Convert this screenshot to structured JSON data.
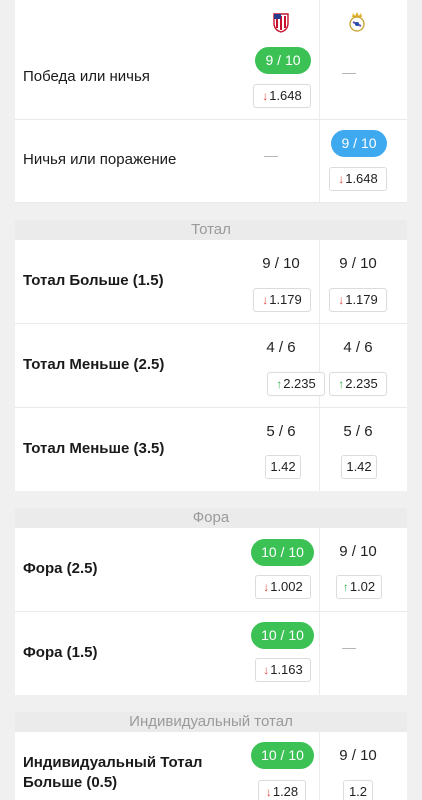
{
  "header": {
    "team1_logo": "atletico-crest-icon",
    "team2_logo": "real-madrid-crest-icon"
  },
  "sections": {
    "total": "Тотал",
    "fora": "Фора",
    "individual": "Индивидуальный тотал"
  },
  "rows": {
    "win_draw": {
      "label": "Победа или ничья",
      "t1_frac": "9 / 10",
      "t1_odds": "1.648",
      "t1_dir": "down"
    },
    "draw_lose": {
      "label": "Ничья или поражение",
      "t2_frac": "9 / 10",
      "t2_odds": "1.648",
      "t2_dir": "down"
    },
    "over15": {
      "label": "Тотал Больше (1.5)",
      "t1_frac": "9 / 10",
      "t1_odds": "1.179",
      "t2_frac": "9 / 10",
      "t2_odds": "1.179"
    },
    "under25": {
      "label": "Тотал Меньше (2.5)",
      "t1_frac": "4 / 6",
      "t1_odds": "2.235",
      "t2_frac": "4 / 6",
      "t2_odds": "2.235"
    },
    "under35": {
      "label": "Тотал Меньше (3.5)",
      "t1_frac": "5 / 6",
      "t1_odds": "1.42",
      "t2_frac": "5 / 6",
      "t2_odds": "1.42"
    },
    "fora25": {
      "label": "Фора (2.5)",
      "t1_frac": "10 / 10",
      "t1_odds": "1.002",
      "t2_frac": "9 / 10",
      "t2_odds": "1.02"
    },
    "fora15": {
      "label": "Фора (1.5)",
      "t1_frac": "10 / 10",
      "t1_odds": "1.163"
    },
    "ind_over05": {
      "label_line1": "Индивидуальный Тотал",
      "label_line2": "Больше (0.5)",
      "t1_frac": "10 / 10",
      "t1_odds": "1.28",
      "t2_frac": "9 / 10",
      "t2_odds": "1.2"
    }
  },
  "arrows": {
    "down": "↓",
    "up": "↑"
  },
  "colors": {
    "green_pill": "#3cc155",
    "blue_pill": "#3fa9f0",
    "down": "#e0443b",
    "up": "#35b24a"
  }
}
